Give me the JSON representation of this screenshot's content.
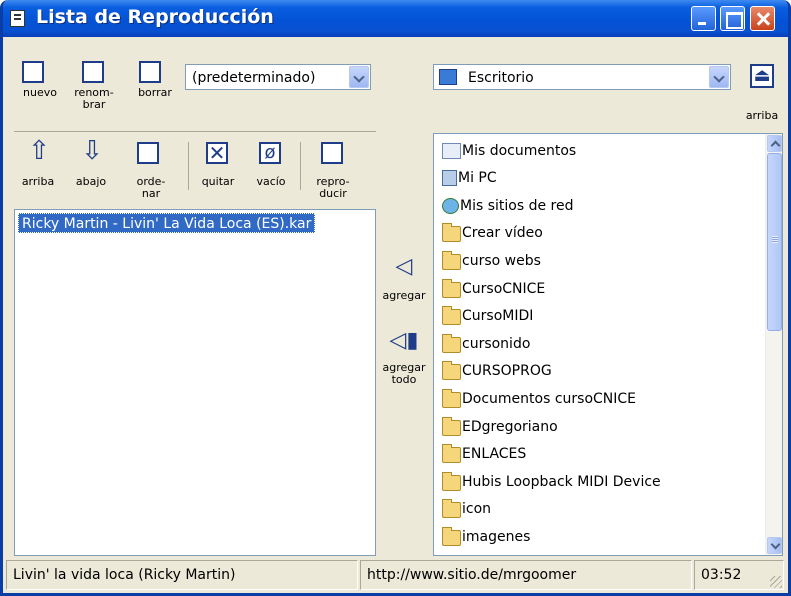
{
  "window": {
    "title": "Lista de Reproducción"
  },
  "toolbar1": {
    "nuevo": "nuevo",
    "renombrar": [
      "renom-",
      "brar"
    ],
    "borrar": "borrar",
    "playlist_combo": "(predeterminado)"
  },
  "toolbar2": {
    "arriba": "arriba",
    "abajo": "abajo",
    "ordenar": [
      "orde-",
      "nar"
    ],
    "quitar": "quitar",
    "vacio": "vacío",
    "reproducir": [
      "repro-",
      "ducir"
    ]
  },
  "folder_combo": "Escritorio",
  "up_folder": "arriba",
  "playlist": [
    "Ricky Martin - Livin' La Vida Loca (ES).kar"
  ],
  "transfer": {
    "agregar": "agregar",
    "agregar_todo": [
      "agregar",
      "todo"
    ]
  },
  "files": [
    {
      "label": "Mis documentos",
      "icon": "documents-folder-icon"
    },
    {
      "label": "Mi PC",
      "icon": "computer-icon"
    },
    {
      "label": "Mis sitios de red",
      "icon": "network-icon"
    },
    {
      "label": "Crear vídeo",
      "icon": "folder-icon"
    },
    {
      "label": "curso webs",
      "icon": "folder-icon"
    },
    {
      "label": "CursoCNICE",
      "icon": "folder-icon"
    },
    {
      "label": "CursoMIDI",
      "icon": "folder-icon"
    },
    {
      "label": "cursonido",
      "icon": "folder-icon"
    },
    {
      "label": "CURSOPROG",
      "icon": "folder-icon"
    },
    {
      "label": "Documentos cursoCNICE",
      "icon": "folder-icon"
    },
    {
      "label": "EDgregoriano",
      "icon": "folder-icon"
    },
    {
      "label": "ENLACES",
      "icon": "folder-icon"
    },
    {
      "label": "Hubis Loopback MIDI Device",
      "icon": "folder-icon"
    },
    {
      "label": "icon",
      "icon": "folder-icon"
    },
    {
      "label": "imagenes",
      "icon": "folder-icon"
    }
  ],
  "statusbar": {
    "song": "Livin' la vida loca (Ricky Martin)",
    "url": "http://www.sitio.de/mrgoomer",
    "time": "03:52"
  }
}
